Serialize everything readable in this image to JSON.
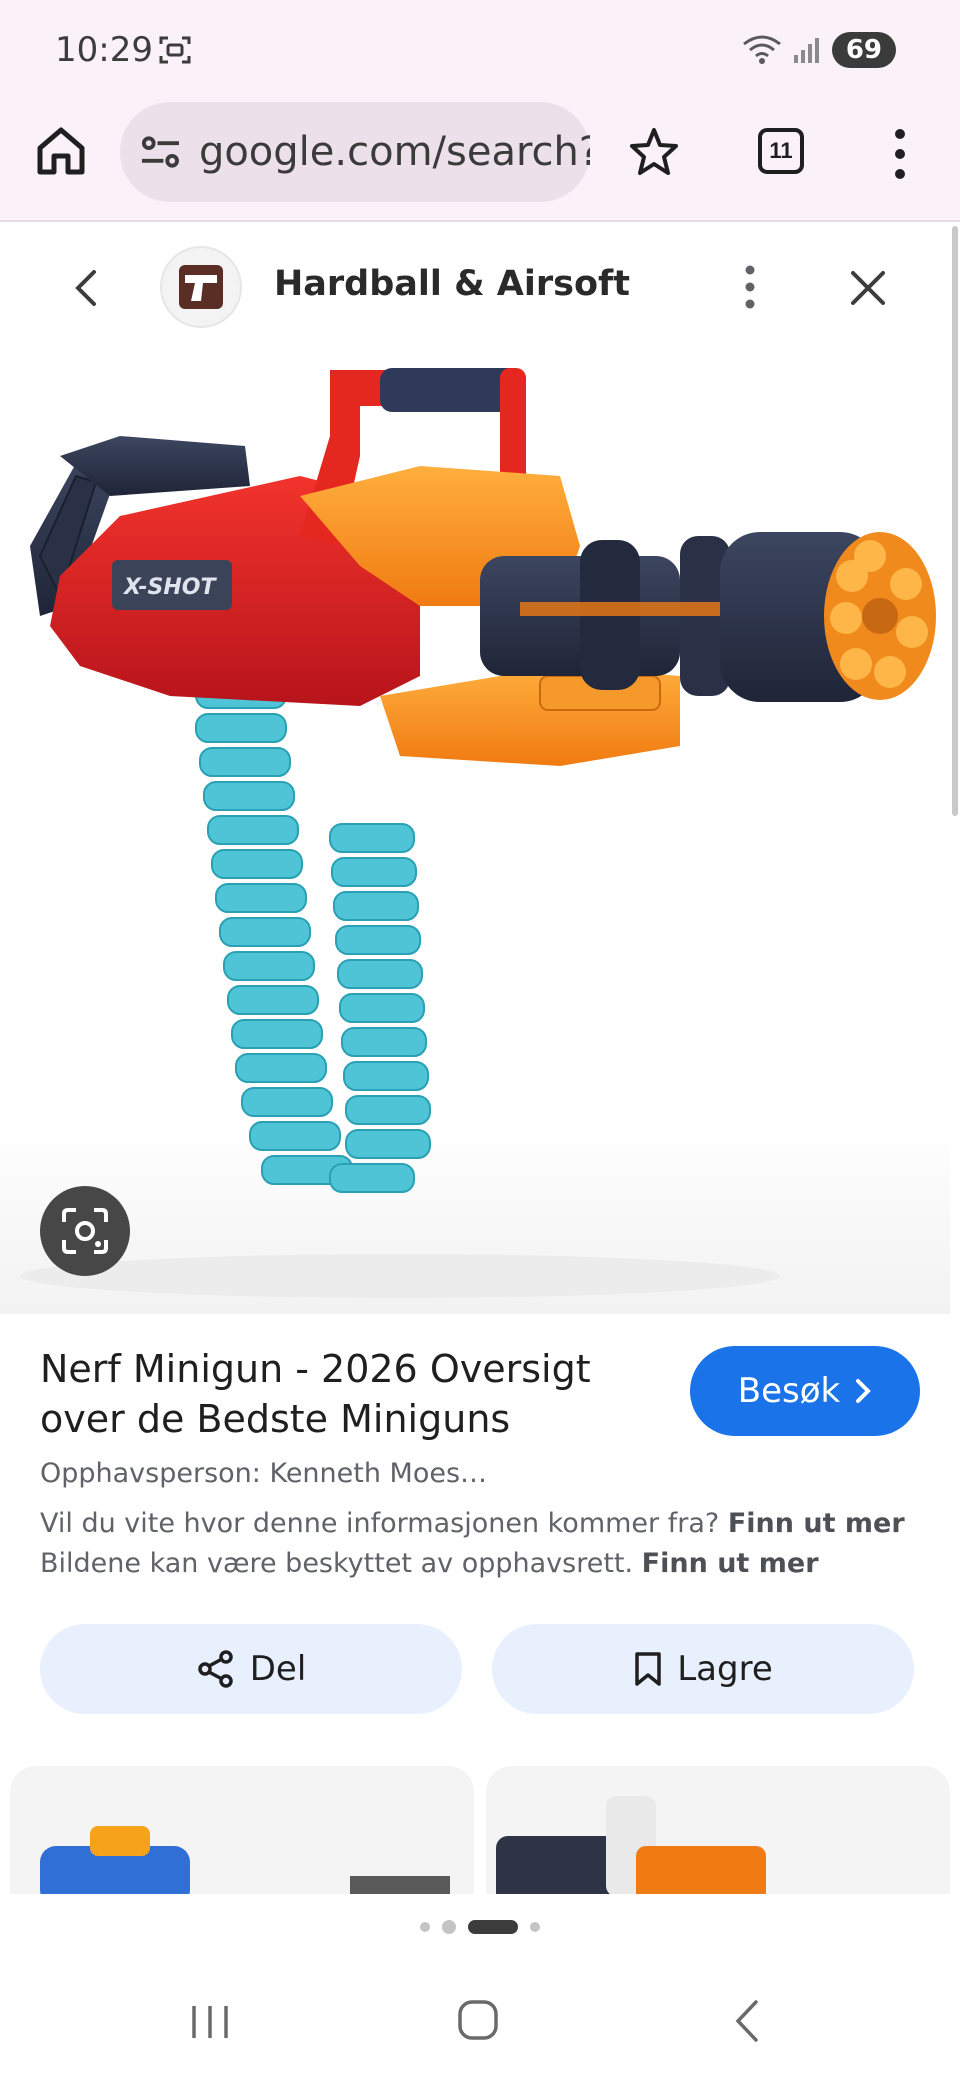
{
  "status_bar": {
    "time": "10:29",
    "battery": "69",
    "icons": [
      "screenshot-icon",
      "wifi-icon",
      "signal-icon",
      "battery-icon"
    ]
  },
  "browser": {
    "url": "google.com/search?",
    "tab_count": "11",
    "icons": [
      "home-icon",
      "tune-icon",
      "star-icon",
      "tabs-icon",
      "more-vert-icon"
    ]
  },
  "viewer": {
    "site_name": "Hardball & Airsoft",
    "icons": [
      "chevron-left-icon",
      "site-favicon",
      "more-vert-icon",
      "close-icon"
    ]
  },
  "image": {
    "logo_text": "X-SHOT",
    "lens_icon": "google-lens-icon"
  },
  "result": {
    "title_line1": "Nerf Minigun - 2026 Oversigt",
    "title_line2": "over de Bedste Miniguns",
    "visit_label": "Besøk",
    "author": "Opphavsperson: Kenneth Moes…",
    "info_text": "Vil du vite hvor denne informasjonen kommer fra?",
    "info_link": "Finn ut mer",
    "copyright_text": "Bildene kan være beskyttet av opphavsrett.",
    "copyright_link": "Finn ut mer"
  },
  "actions": {
    "share_label": "Del",
    "save_label": "Lagre"
  },
  "colors": {
    "accent": "#1a73e8",
    "chrome_bg": "#fbf1f8",
    "action_bg": "#e8f0fe"
  },
  "pager": {
    "total": 4,
    "active": 3
  }
}
